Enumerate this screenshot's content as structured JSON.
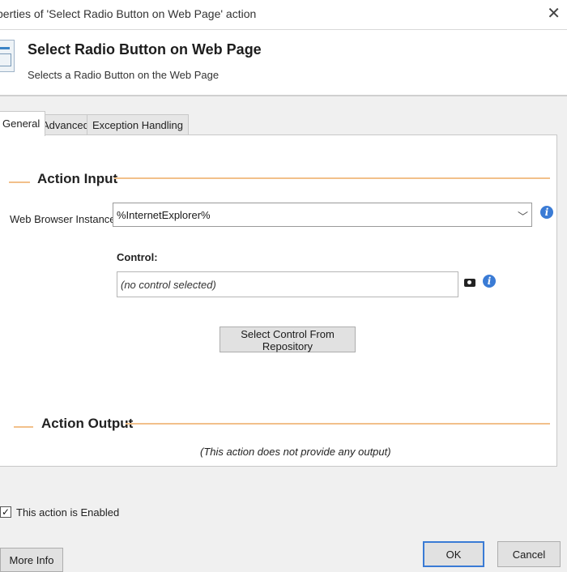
{
  "window": {
    "title": "perties of 'Select Radio Button on Web Page' action"
  },
  "header": {
    "title": "Select Radio Button on Web Page",
    "subtitle": "Selects a Radio Button on the Web Page"
  },
  "tabs": [
    {
      "label": "General",
      "active": true
    },
    {
      "label": "Advanced",
      "active": false
    },
    {
      "label": "Exception Handling",
      "active": false
    }
  ],
  "action_input": {
    "heading": "Action Input",
    "browser_label": "Web Browser Instance:",
    "browser_value": "%InternetExplorer%",
    "control_label": "Control:",
    "control_value": "(no control selected)",
    "repository_button": "Select Control From Repository"
  },
  "action_output": {
    "heading": "Action Output",
    "note": "(This action does not provide any output)"
  },
  "footer": {
    "enabled_label": "This action is Enabled",
    "enabled_checked": true,
    "more_info": "More Info",
    "ok": "OK",
    "cancel": "Cancel"
  },
  "colors": {
    "section_line": "#f2c08a",
    "info_icon": "#3a7bd5",
    "ok_border": "#3a7bd5"
  }
}
